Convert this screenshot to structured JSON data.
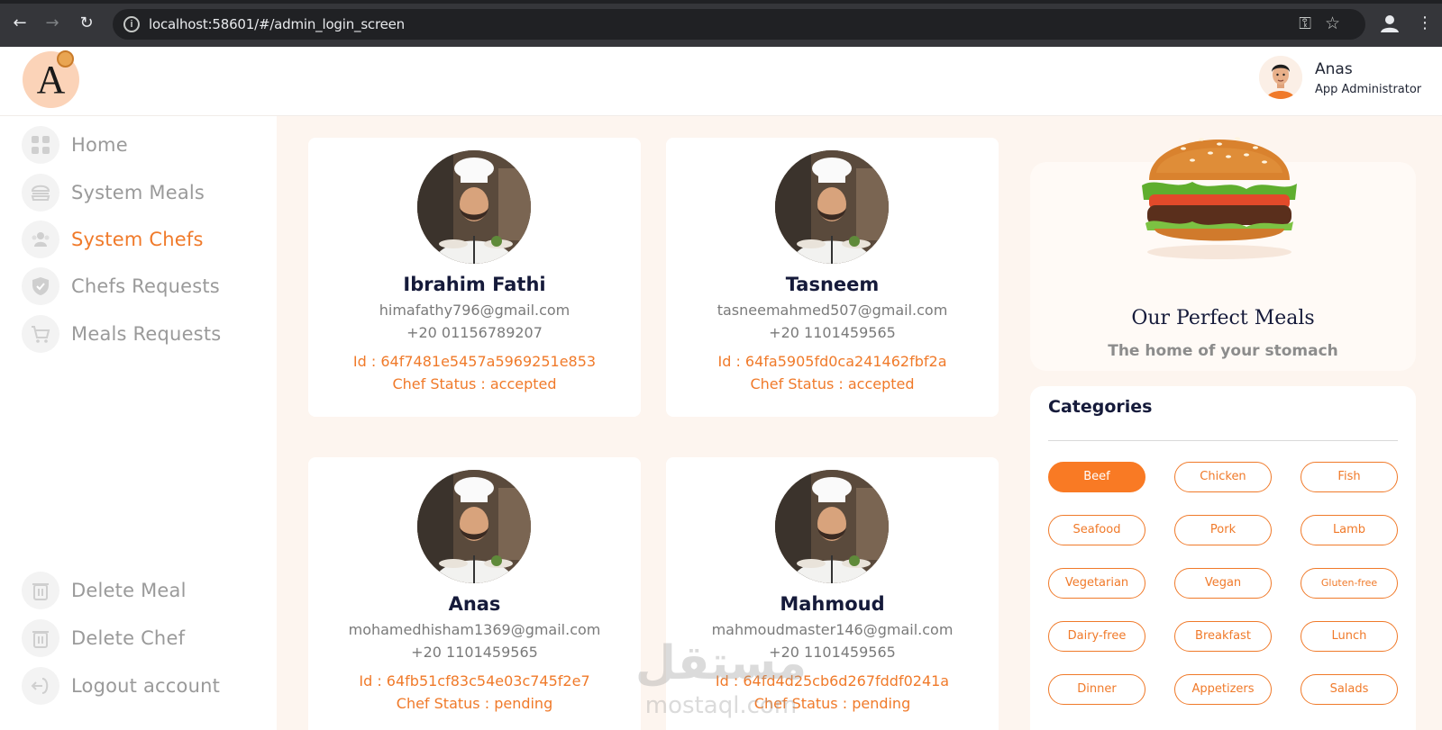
{
  "browser": {
    "url": "localhost:58601/#/admin_login_screen"
  },
  "header": {
    "logo_letter": "A",
    "admin_name": "Anas",
    "admin_role": "App Administrator"
  },
  "sidebar": {
    "items": [
      {
        "label": "Home",
        "icon": "grid-icon"
      },
      {
        "label": "System Meals",
        "icon": "burger-icon"
      },
      {
        "label": "System Chefs",
        "icon": "users-icon",
        "active": true
      },
      {
        "label": "Chefs Requests",
        "icon": "shield-check-icon"
      },
      {
        "label": "Meals Requests",
        "icon": "cart-icon"
      }
    ],
    "bottom_items": [
      {
        "label": "Delete Meal",
        "icon": "trash-icon"
      },
      {
        "label": "Delete Chef",
        "icon": "trash-icon"
      },
      {
        "label": "Logout account",
        "icon": "logout-icon"
      }
    ]
  },
  "chefs": [
    {
      "name": "Ibrahim Fathi",
      "email": "himafathy796@gmail.com",
      "phone": "+20 01156789207",
      "id": "Id : 64f7481e5457a5969251e853",
      "status": "Chef Status : accepted"
    },
    {
      "name": "Tasneem",
      "email": "tasneemahmed507@gmail.com",
      "phone": "+20 1101459565",
      "id": "Id : 64fa5905fd0ca241462fbf2a",
      "status": "Chef Status : accepted"
    },
    {
      "name": "Anas",
      "email": "mohamedhisham1369@gmail.com",
      "phone": "+20 1101459565",
      "id": "Id : 64fb51cf83c54e03c745f2e7",
      "status": "Chef Status : pending"
    },
    {
      "name": "Mahmoud",
      "email": "mahmoudmaster146@gmail.com",
      "phone": "+20 1101459565",
      "id": "Id : 64fd4d25cb6d267fddf0241a",
      "status": "Chef Status : pending"
    }
  ],
  "promo": {
    "title": "Our Perfect Meals",
    "subtitle": "The home of your stomach"
  },
  "categories": {
    "title": "Categories",
    "items": [
      "Beef",
      "Chicken",
      "Fish",
      "Seafood",
      "Pork",
      "Lamb",
      "Vegetarian",
      "Vegan",
      "Gluten-free",
      "Dairy-free",
      "Breakfast",
      "Lunch",
      "Dinner",
      "Appetizers",
      "Salads"
    ],
    "selected": "Beef"
  },
  "watermark": {
    "arabic": "مستقل",
    "latin": "mostaql.com"
  },
  "colors": {
    "accent": "#f07a2a",
    "sidebar_text": "#9a9a9a",
    "main_bg": "#fdf5ef",
    "dark_text": "#151a3a"
  }
}
